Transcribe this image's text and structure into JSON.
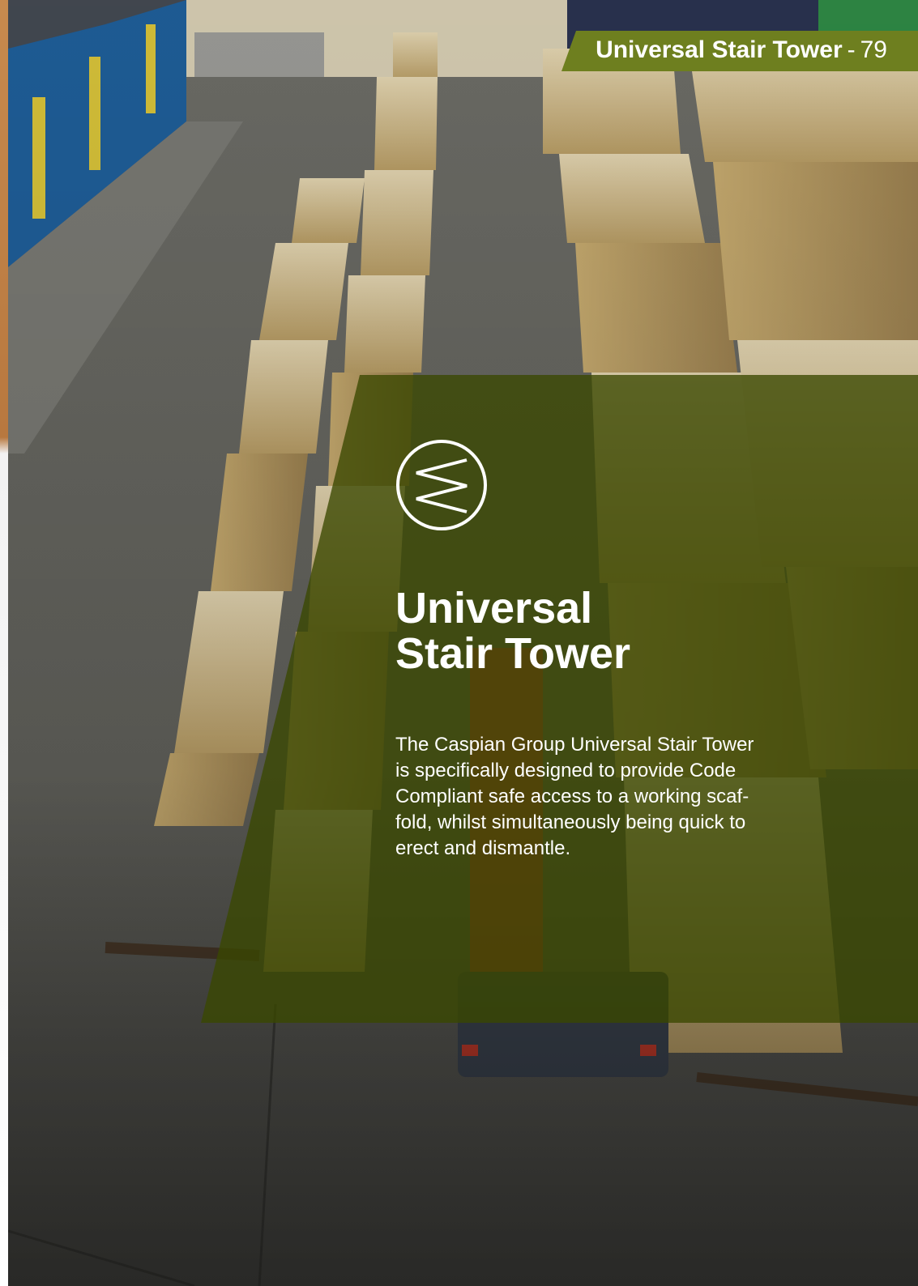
{
  "header": {
    "title": "Universal Stair Tower",
    "separator": "-",
    "page_number": "79"
  },
  "logo": {
    "icon": "caspian-logo-icon"
  },
  "main": {
    "title_lines": [
      "Universal",
      "Stair Tower"
    ],
    "body_lines": [
      "The Caspian Group Universal Stair Tower",
      "is specifically designed to provide Code",
      "Compliant safe access to a working scaf-",
      "fold, whilst simultaneously being quick to",
      "erect and dismantle."
    ]
  },
  "colors": {
    "accent": "#6e7f1f",
    "panel": "#3a4800",
    "text": "#ffffff"
  }
}
